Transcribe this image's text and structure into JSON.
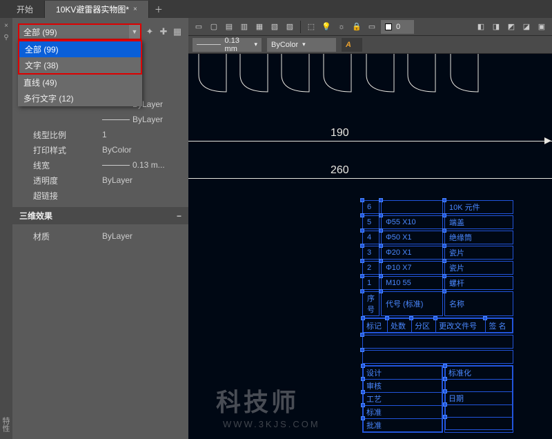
{
  "tabs": {
    "start": "开始",
    "file": "10KV避雷器实物图*"
  },
  "selector": {
    "current": "全部 (99)"
  },
  "dropdown": {
    "all": "全部 (99)",
    "text": "文字 (38)",
    "line": "直线 (49)",
    "mtext": "多行文字 (12)"
  },
  "props": {
    "linescale_label": "线型比例",
    "linescale_value": "1",
    "plotstyle_label": "打印样式",
    "plotstyle_value": "ByColor",
    "lineweight_label": "线宽",
    "lineweight_value": "0.13 m...",
    "transparency_label": "透明度",
    "transparency_value": "ByLayer",
    "hyperlink_label": "超链接",
    "sec1_right_value1": "ByLayer",
    "sec1_right_value2": "ByLayer"
  },
  "section3d": {
    "header": "三维效果"
  },
  "material": {
    "label": "材质",
    "value": "ByLayer"
  },
  "toolbar2": {
    "lineweight": "0.13 mm",
    "color": "ByColor",
    "zero": "0"
  },
  "drawing": {
    "dim1": "190",
    "dim2": "260"
  },
  "watermark": {
    "main": "科技师",
    "sub": "WWW.3KJS.COM"
  },
  "sidebar_label": "特性",
  "chart_data": {
    "type": "table",
    "note": "Selected CAD title-block table cells (blue grips). Rows top-to-bottom.",
    "rows": [
      {
        "seq": "6",
        "spec": "",
        "name": "10K 元件"
      },
      {
        "seq": "5",
        "spec": "Φ55 X10",
        "name": "端盖"
      },
      {
        "seq": "4",
        "spec": "Φ50 X1",
        "name": "绝缘筒"
      },
      {
        "seq": "3",
        "spec": "Φ20 X1",
        "name": "瓷片"
      },
      {
        "seq": "2",
        "spec": "Φ10 X7",
        "name": "瓷片"
      },
      {
        "seq": "1",
        "spec": "M10 55",
        "name": "螺杆"
      },
      {
        "seq": "序号",
        "spec": "代号 (标准)",
        "name": "名称"
      }
    ],
    "footer_row": [
      "标记",
      "处数",
      "分区",
      "更改文件号",
      "签 名"
    ],
    "side_labels": [
      "设计",
      "审核",
      "工艺",
      "标准",
      "批准"
    ],
    "side_labels_r": [
      "标准化",
      "日期"
    ]
  }
}
